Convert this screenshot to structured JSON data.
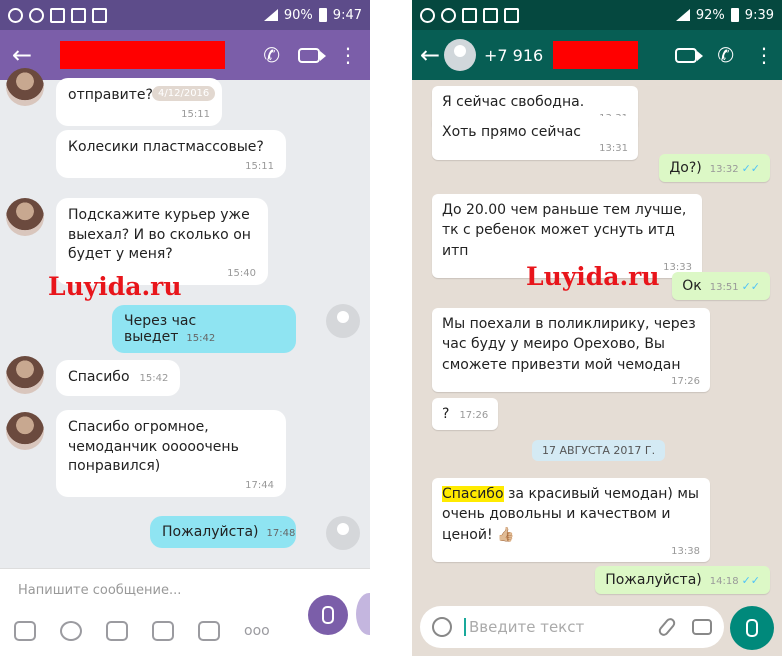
{
  "viber": {
    "status": {
      "time": "9:47",
      "battery": "90%"
    },
    "header": {
      "back": "←"
    },
    "messages": [
      {
        "text": "отправите?",
        "time": "15:11",
        "date_chip": "4/12/2016"
      },
      {
        "text": "Колесики пластмассовые?",
        "time": "15:11"
      },
      {
        "text": "Подскажите курьер уже выехал? И во сколько он будет у меня?",
        "time": "15:40"
      },
      {
        "text": "Через час выедет",
        "time": "15:42",
        "outgoing": true
      },
      {
        "text": "Спасибо",
        "time": "15:42"
      },
      {
        "text": "Спасибо огромное, чемоданчик ооооочень понравился)",
        "time": "17:44"
      },
      {
        "text": "Пожалуйста)",
        "time": "17:48",
        "outgoing": true
      }
    ],
    "input_placeholder": "Напишите сообщение...",
    "tools_more": "ooo"
  },
  "whatsapp": {
    "status": {
      "time": "9:39",
      "battery": "92%"
    },
    "header": {
      "back": "←",
      "number": "+7 916"
    },
    "messages": [
      {
        "text": "Я сейчас свободна.",
        "time": "13:31"
      },
      {
        "text": "Хоть прямо сейчас",
        "time": "13:31"
      },
      {
        "text": "До?)",
        "time": "13:32",
        "outgoing": true
      },
      {
        "text": "До 20.00 чем раньше тем лучше, тк с ребенок может уснуть итд итп",
        "time": "13:33"
      },
      {
        "text": "Ок",
        "time": "13:51",
        "outgoing": true
      },
      {
        "text": "Мы поехали в поликлирику, через час буду у меиро Орехово, Вы сможете привезти мой чемодан",
        "time": "17:26"
      },
      {
        "text": "?",
        "time": "17:26"
      },
      {
        "highlight": "Спасибо",
        "text": " за красивый чемодан) мы очень довольны и качеством и ценой! 👍🏼",
        "time": "13:38"
      },
      {
        "text": "Пожалуйста)",
        "time": "14:18",
        "outgoing": true
      }
    ],
    "date_divider": "17 АВГУСТА 2017 Г.",
    "input_placeholder": "Введите текст"
  },
  "watermark": "Luyida.ru",
  "colors": {
    "viber_header": "#7b5ea9",
    "viber_out": "#8fe4f2",
    "wa_header": "#075e54",
    "wa_out": "#dcf8c6",
    "watermark": "#e8151b"
  }
}
